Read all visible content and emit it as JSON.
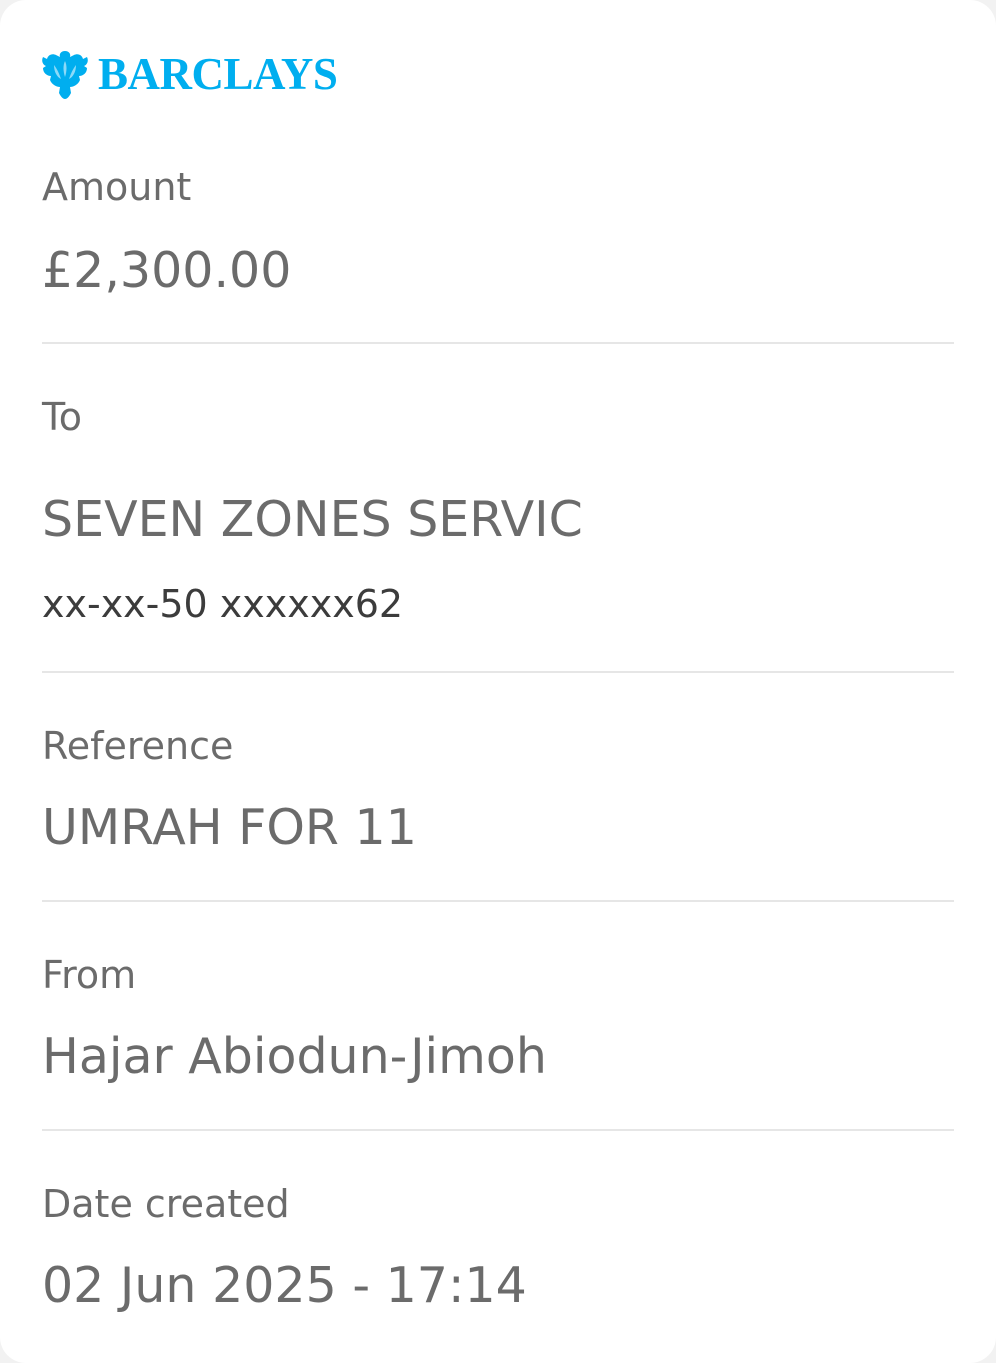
{
  "brand": {
    "logo_icon": "eagle-icon",
    "name": "BARCLAYS",
    "color": "#00aeef"
  },
  "details": {
    "amount": {
      "label": "Amount",
      "value": "£2,300.00"
    },
    "to": {
      "label": "To",
      "name": "SEVEN ZONES SERVIC",
      "account": "xx-xx-50 xxxxxx62"
    },
    "reference": {
      "label": "Reference",
      "value": "UMRAH FOR 11"
    },
    "from": {
      "label": "From",
      "value": "Hajar Abiodun-Jimoh"
    },
    "date_created": {
      "label": "Date created",
      "value": "02 Jun 2025 - 17:14"
    }
  },
  "colors": {
    "text": "#6b6b6b",
    "text_dark": "#3c3c3c",
    "divider": "#e6e6e6",
    "background": "#ffffff"
  }
}
